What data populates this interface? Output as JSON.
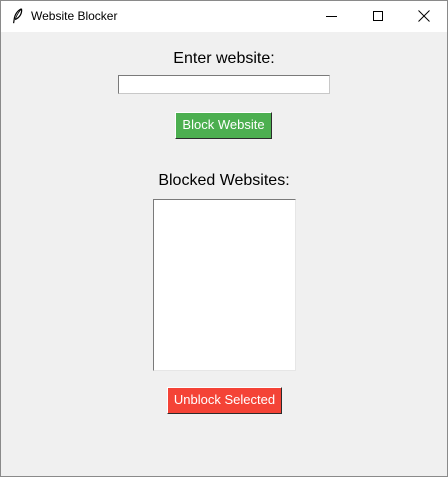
{
  "window": {
    "title": "Website Blocker",
    "app_icon": "feather-icon",
    "controls": {
      "minimize_icon": "minimize-icon",
      "maximize_icon": "maximize-icon",
      "close_icon": "close-icon"
    }
  },
  "form": {
    "enter_label": "Enter website:",
    "website_input": {
      "value": "",
      "placeholder": ""
    },
    "block_button_label": "Block Website"
  },
  "blocked": {
    "label": "Blocked Websites:",
    "items": [],
    "unblock_button_label": "Unblock Selected"
  },
  "colors": {
    "window_background": "#f0f0f0",
    "titlebar_background": "#ffffff",
    "block_button": "#4caf50",
    "unblock_button": "#f44336",
    "button_text": "#ffffff"
  }
}
